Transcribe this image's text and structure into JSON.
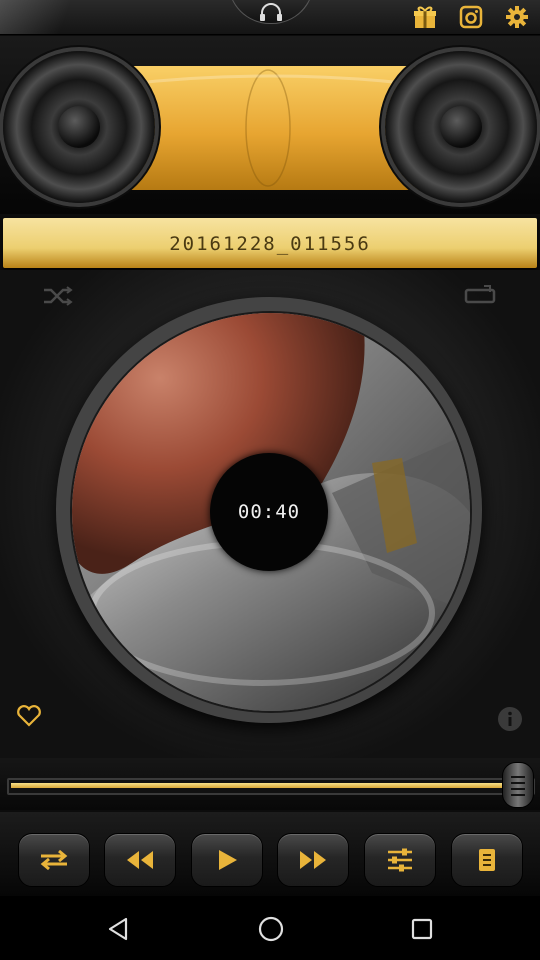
{
  "header": {
    "icons": [
      "headphones-icon",
      "gift-icon",
      "instagram-icon",
      "settings-icon"
    ]
  },
  "player": {
    "track_title": "20161228_011556",
    "elapsed_time": "00:40",
    "progress": 0.97,
    "colors": {
      "accent_gold": "#e7a531",
      "title_text": "#4a3a12"
    }
  },
  "controls": {
    "buttons": [
      "repeat-icon",
      "rewind-icon",
      "play-icon",
      "fast-forward-icon",
      "equalizer-icon",
      "playlist-icon"
    ]
  },
  "side_icons": [
    "shuffle-icon",
    "crop-icon",
    "heart-icon",
    "info-icon"
  ],
  "navbar": {
    "buttons": [
      "back-icon",
      "home-icon",
      "recents-icon"
    ]
  }
}
